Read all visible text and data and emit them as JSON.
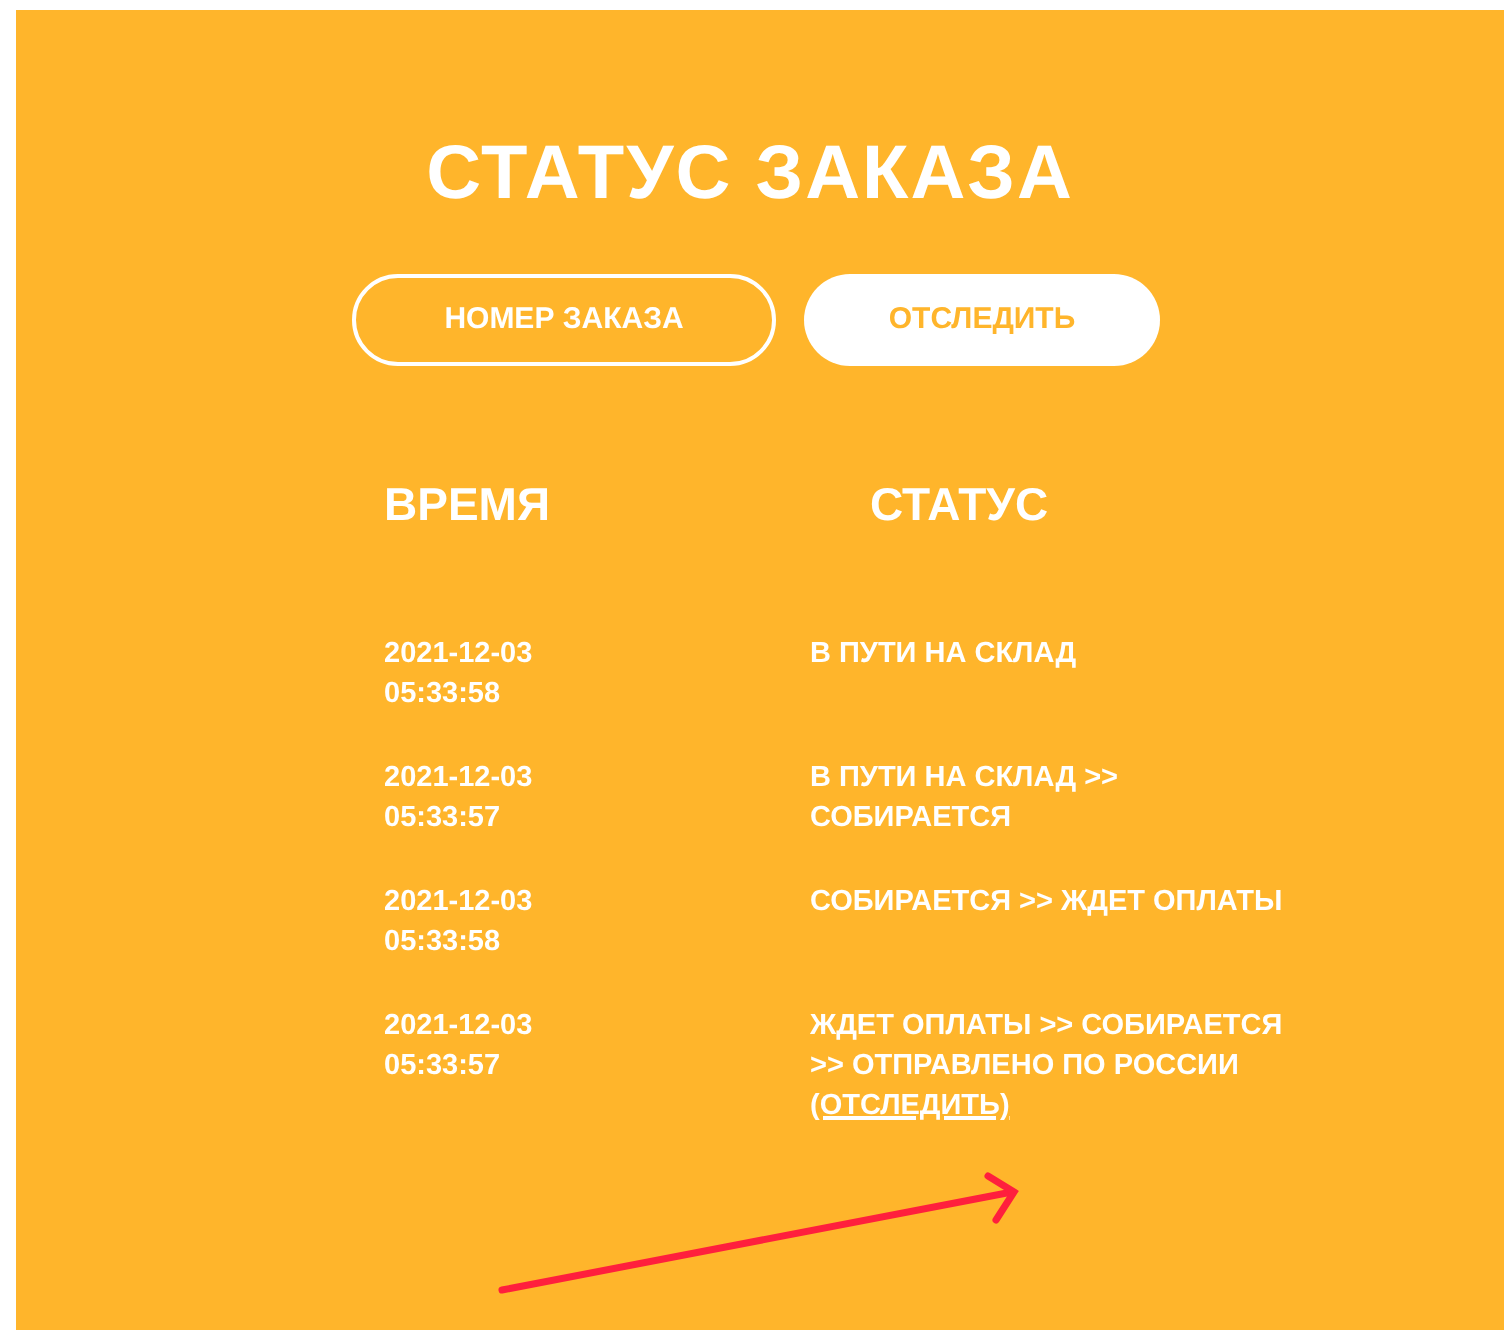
{
  "title": "СТАТУС ЗАКАЗА",
  "search": {
    "placeholder": "НОМЕР ЗАКАЗА",
    "button": "ОТСЛЕДИТЬ"
  },
  "table": {
    "columns": [
      "ВРЕМЯ",
      "СТАТУС"
    ],
    "rows": [
      {
        "time": "2021-12-03 05:33:58",
        "status": "В ПУТИ НА СКЛАД"
      },
      {
        "time": "2021-12-03 05:33:57",
        "status": "В ПУТИ НА СКЛАД >> СОБИРАЕТСЯ"
      },
      {
        "time": "2021-12-03 05:33:58",
        "status": "СОБИРАЕТСЯ >> ЖДЕТ ОПЛАТЫ"
      },
      {
        "time": "2021-12-03 05:33:57",
        "status": "ЖДЕТ ОПЛАТЫ >> СОБИРАЕТСЯ >> ОТПРАВЛЕНО ПО РОССИИ",
        "link": "(ОТСЛЕДИТЬ)"
      }
    ]
  },
  "annotation": {
    "kind": "arrow"
  }
}
